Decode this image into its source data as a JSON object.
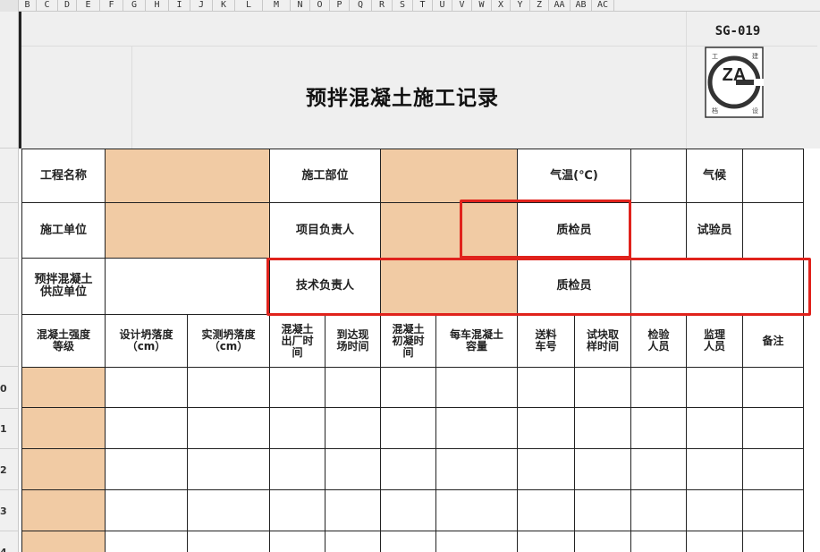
{
  "spreadsheet": {
    "columns": [
      "B",
      "C",
      "D",
      "E",
      "F",
      "G",
      "H",
      "I",
      "J",
      "K",
      "L",
      "M",
      "N",
      "O",
      "P",
      "Q",
      "R",
      "S",
      "T",
      "U",
      "V",
      "W",
      "X",
      "Y",
      "Z",
      "AA",
      "AB",
      "AC"
    ],
    "row_numbers": [
      "0",
      "1",
      "2",
      "3",
      "4"
    ]
  },
  "form": {
    "code": "SG-019",
    "title": "预拌混凝土施工记录",
    "logo": {
      "text": "ZA",
      "corner_chars": [
        "工",
        "建",
        "档",
        "设"
      ],
      "icon": "za-logo-icon"
    }
  },
  "labels": {
    "project_name": "工程名称",
    "construction_part": "施工部位",
    "temperature": "气温(℃)",
    "weather": "气候",
    "construction_unit": "施工单位",
    "project_leader": "项目负责人",
    "quality_inspector_1": "质检员",
    "tester": "试验员",
    "supplier": "预拌混凝土\n供应单位",
    "technical_leader": "技术负责人",
    "quality_inspector_2": "质检员"
  },
  "columns": [
    "混凝土强度等级",
    "设计坍落度（cm）",
    "实测坍落度（cm）",
    "混凝土出厂时间",
    "到达现场时间",
    "混凝土初凝时间",
    "每车混凝土容量",
    "送料车号",
    "试块取样时间",
    "检验人员",
    "监理人员",
    "备注"
  ],
  "columns_display": [
    "混凝土强度\n等级",
    "设计坍落度\n（cm）",
    "实测坍落度\n（cm）",
    "混凝土\n出厂时\n间",
    "到达现\n场时间",
    "混凝土\n初凝时\n间",
    "每车混凝土\n容量",
    "送料\n车号",
    "试块取\n样时间",
    "检验\n人员",
    "监理\n人员",
    "备注"
  ],
  "colors": {
    "input_fill": "#f1cba4",
    "highlight": "#e0221c",
    "header_bg": "#efefef"
  }
}
